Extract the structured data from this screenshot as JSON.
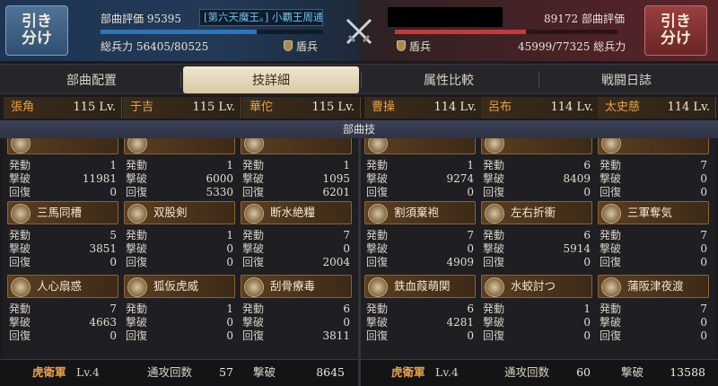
{
  "header": {
    "left": {
      "retreat_label": "引き分け",
      "rating_label": "部曲評価",
      "rating_value": "95395",
      "alliance": "[第六天魔王。] 小覇王周通",
      "force_label": "総兵力",
      "force_value": "56405/80525",
      "troop_type": "盾兵",
      "hp_fraction": 0.7
    },
    "right": {
      "retreat_label": "引き分け",
      "rating_label": "部曲評価",
      "rating_value": "89172",
      "force_label": "総兵力",
      "force_value": "45999/77325",
      "troop_type": "盾兵",
      "hp_fraction": 0.59
    },
    "center_icon": "crossed-swords-icon"
  },
  "tabs": [
    {
      "label": "部曲配置"
    },
    {
      "label": "技詳細",
      "active": true
    },
    {
      "label": "属性比較"
    },
    {
      "label": "戦闘日誌"
    }
  ],
  "generals_left": [
    {
      "name": "張角",
      "level": "115 Lv."
    },
    {
      "name": "于吉",
      "level": "115 Lv."
    },
    {
      "name": "華佗",
      "level": "115 Lv."
    }
  ],
  "generals_right": [
    {
      "name": "曹操",
      "level": "114 Lv."
    },
    {
      "name": "呂布",
      "level": "114 Lv."
    },
    {
      "name": "太史慈",
      "level": "114 Lv."
    }
  ],
  "section_title": "部曲技",
  "stat_labels": {
    "trigger": "発動",
    "kill": "撃破",
    "heal": "回復"
  },
  "left_skills": [
    [
      {
        "name": "",
        "trigger": "1",
        "kill": "11981",
        "heal": "0"
      },
      {
        "name": "",
        "trigger": "1",
        "kill": "6000",
        "heal": "5330"
      },
      {
        "name": "",
        "trigger": "1",
        "kill": "1095",
        "heal": "6201"
      }
    ],
    [
      {
        "name": "三馬同槽",
        "trigger": "5",
        "kill": "3851",
        "heal": "0"
      },
      {
        "name": "双股剣",
        "trigger": "1",
        "kill": "0",
        "heal": "0"
      },
      {
        "name": "断水絶糧",
        "trigger": "7",
        "kill": "0",
        "heal": "2004"
      }
    ],
    [
      {
        "name": "人心扇惑",
        "trigger": "7",
        "kill": "4663",
        "heal": "0"
      },
      {
        "name": "狐仮虎威",
        "trigger": "1",
        "kill": "0",
        "heal": "0"
      },
      {
        "name": "刮骨療毒",
        "trigger": "6",
        "kill": "0",
        "heal": "3811"
      }
    ]
  ],
  "right_skills": [
    [
      {
        "name": "",
        "trigger": "1",
        "kill": "9274",
        "heal": "0"
      },
      {
        "name": "",
        "trigger": "6",
        "kill": "8409",
        "heal": "0"
      },
      {
        "name": "",
        "trigger": "7",
        "kill": "0",
        "heal": "0"
      }
    ],
    [
      {
        "name": "割須棄袍",
        "trigger": "7",
        "kill": "0",
        "heal": "4909"
      },
      {
        "name": "左右折衝",
        "trigger": "6",
        "kill": "5914",
        "heal": "0"
      },
      {
        "name": "三軍奪気",
        "trigger": "7",
        "kill": "0",
        "heal": "0"
      }
    ],
    [
      {
        "name": "鉄血葭萌関",
        "trigger": "6",
        "kill": "4281",
        "heal": "0"
      },
      {
        "name": "水蛟討つ",
        "trigger": "1",
        "kill": "0",
        "heal": "0"
      },
      {
        "name": "蒲阪津夜渡",
        "trigger": "7",
        "kill": "0",
        "heal": "0"
      }
    ]
  ],
  "footer": {
    "left": {
      "unit": "虎衛軍",
      "level": "Lv.4",
      "attacks_label": "通攻回数",
      "attacks": "57",
      "kills_label": "撃破",
      "kills": "8645"
    },
    "right": {
      "unit": "虎衛軍",
      "level": "Lv.4",
      "attacks_label": "通攻回数",
      "attacks": "60",
      "kills_label": "撃破",
      "kills": "13588"
    }
  }
}
